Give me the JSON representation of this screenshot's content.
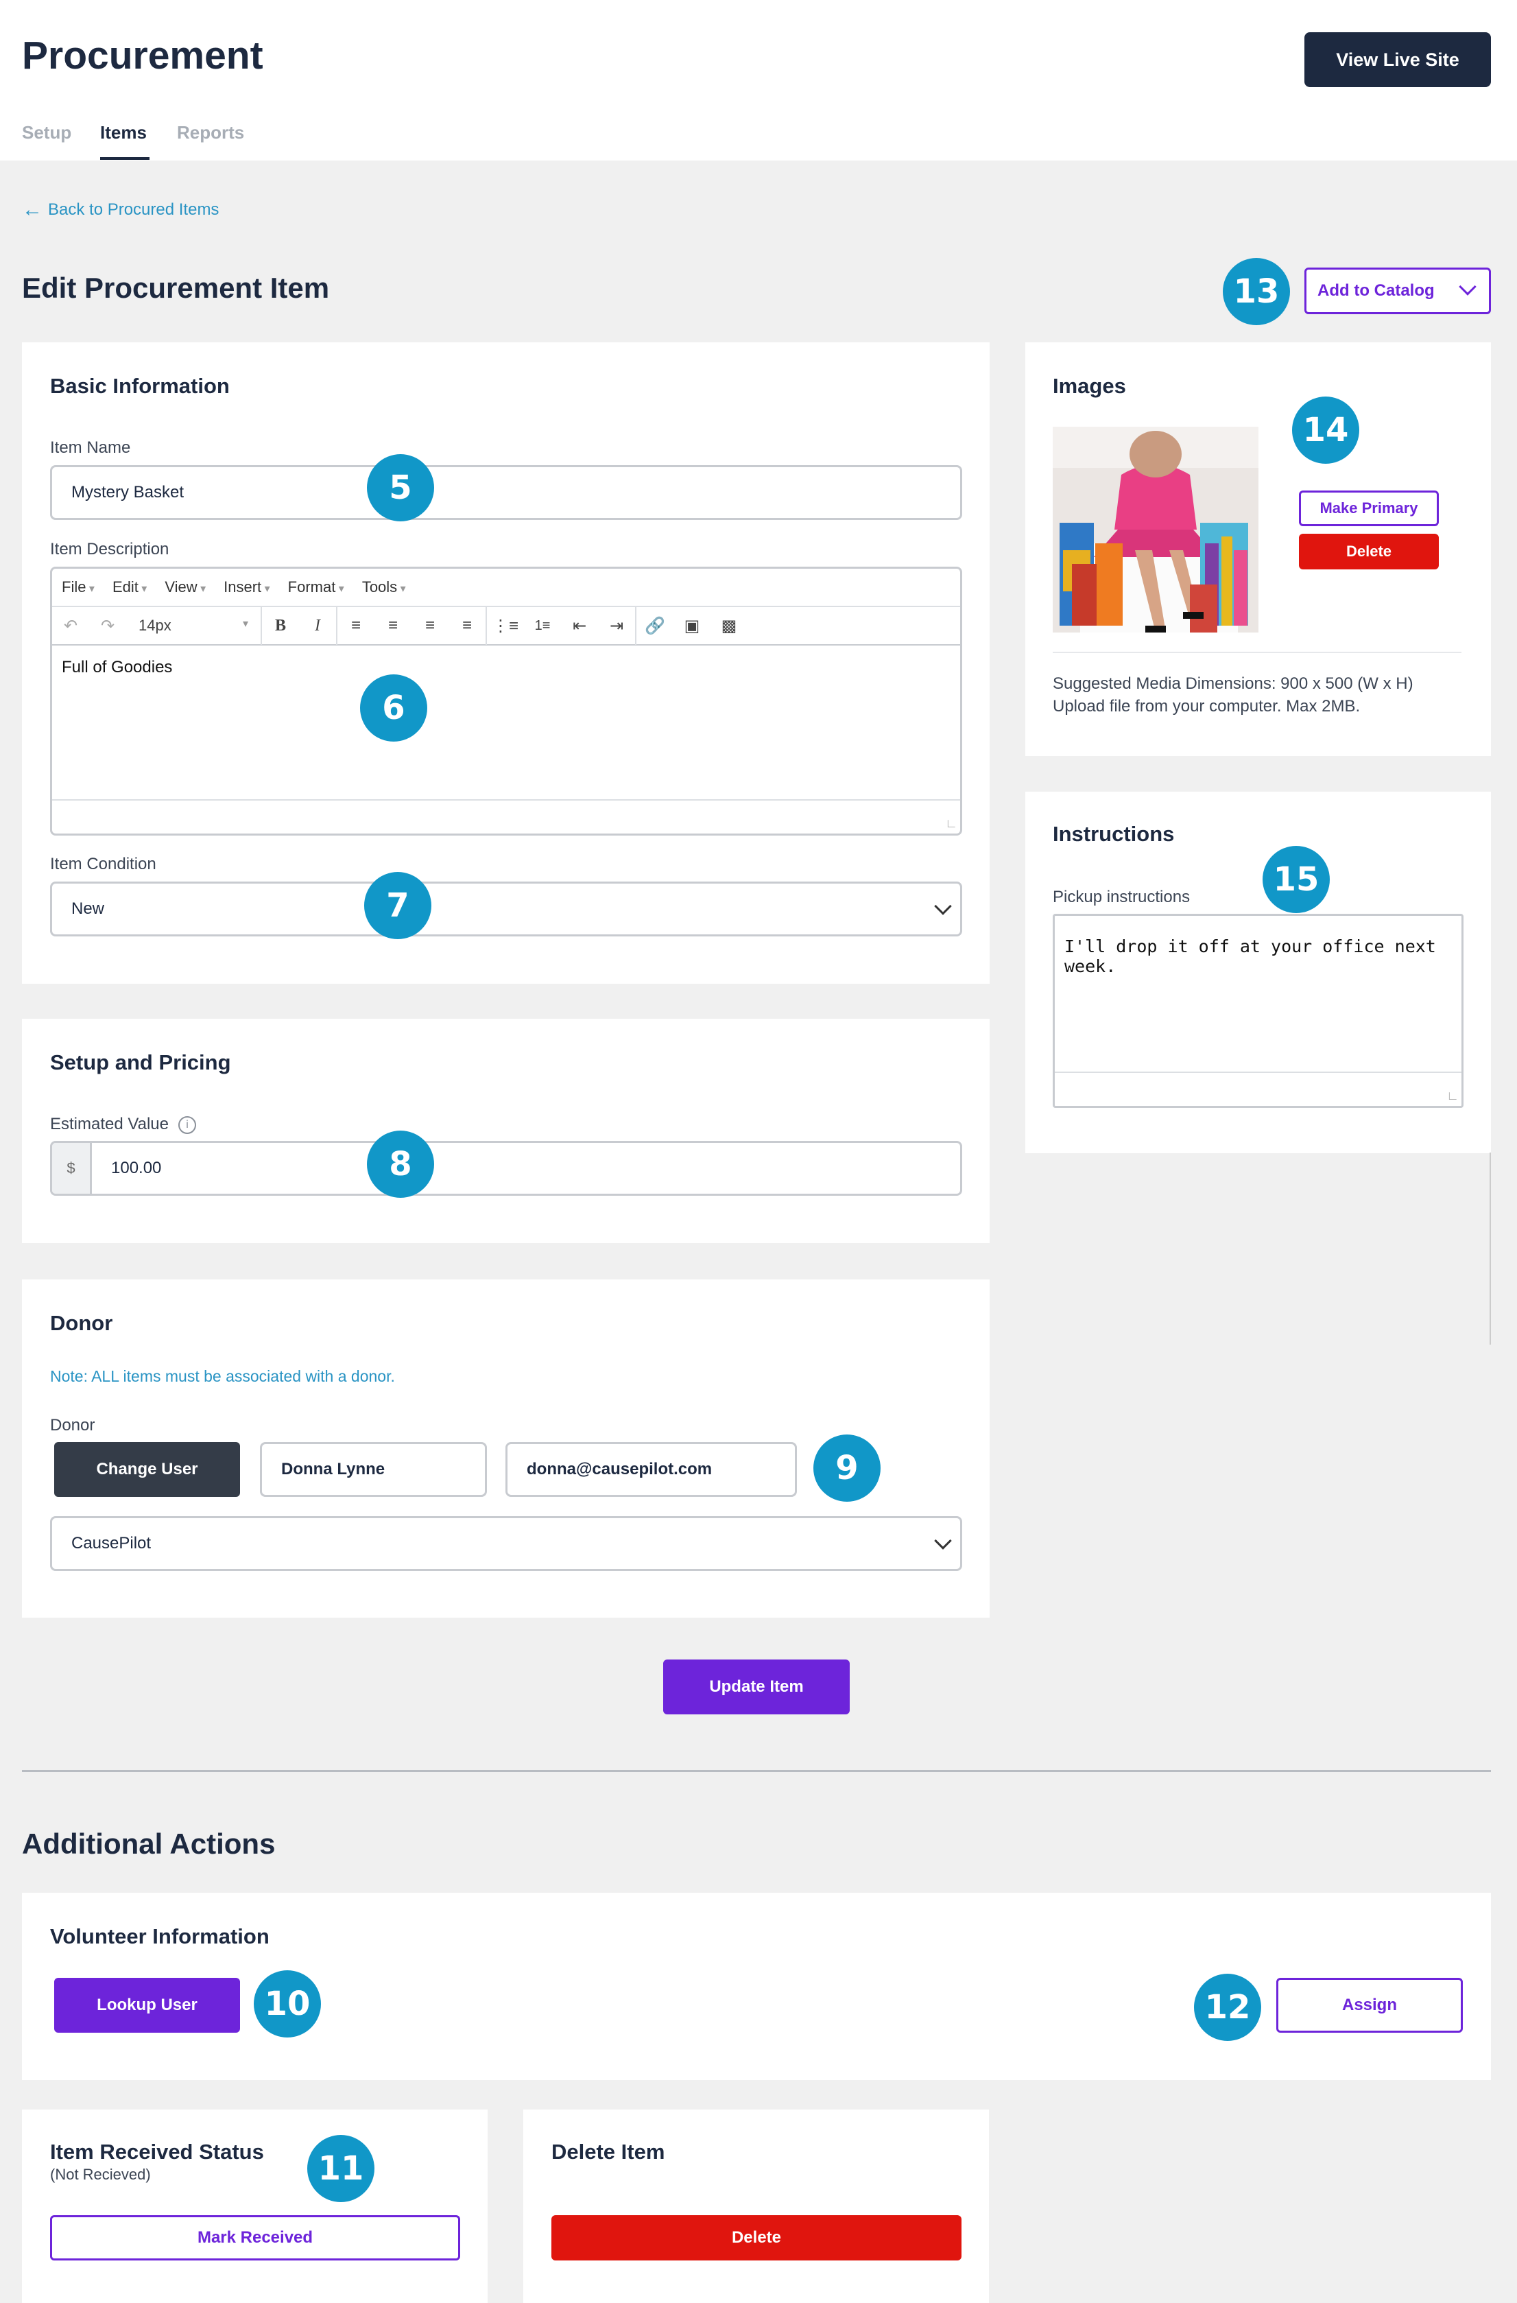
{
  "header": {
    "title": "Procurement",
    "view_live_site": "View Live Site",
    "tabs": [
      "Setup",
      "Items",
      "Reports"
    ],
    "active_tab": "Items"
  },
  "back_link": "Back to Procured Items",
  "page_title": "Edit Procurement Item",
  "add_to_catalog": "Add to Catalog",
  "basic_info": {
    "title": "Basic Information",
    "item_name_label": "Item Name",
    "item_name": "Mystery Basket",
    "description_label": "Item Description",
    "editor_menu": [
      "File",
      "Edit",
      "View",
      "Insert",
      "Format",
      "Tools"
    ],
    "font_size": "14px",
    "description": "Full of Goodies",
    "condition_label": "Item Condition",
    "condition": "New"
  },
  "pricing": {
    "title": "Setup and Pricing",
    "estimated_value_label": "Estimated Value",
    "currency": "$",
    "estimated_value": "100.00"
  },
  "donor": {
    "title": "Donor",
    "note": "Note: ALL items must be associated with a donor.",
    "label": "Donor",
    "change_user": "Change User",
    "name": "Donna Lynne",
    "email": "donna@causepilot.com",
    "organization": "CausePilot"
  },
  "update_item": "Update Item",
  "images": {
    "title": "Images",
    "make_primary": "Make Primary",
    "delete": "Delete",
    "suggested": "Suggested Media Dimensions: 900 x 500 (W x H)",
    "upload": "Upload file from your computer. Max 2MB."
  },
  "instructions": {
    "title": "Instructions",
    "label": "Pickup instructions",
    "text": "I'll drop it off at your office next week."
  },
  "additional_actions": {
    "title": "Additional Actions",
    "volunteer_title": "Volunteer Information",
    "lookup_user": "Lookup User",
    "assign": "Assign",
    "received_title": "Item Received Status",
    "received_status": "(Not Recieved)",
    "mark_received": "Mark Received",
    "delete_title": "Delete Item",
    "delete_button": "Delete"
  },
  "badges": [
    "5",
    "6",
    "7",
    "8",
    "9",
    "10",
    "11",
    "12",
    "13",
    "14",
    "15"
  ],
  "colors": {
    "navy": "#1d2940",
    "purple": "#6d24da",
    "red": "#e0150e",
    "badge_blue": "#1197c8",
    "link_blue": "#2a94c4"
  }
}
